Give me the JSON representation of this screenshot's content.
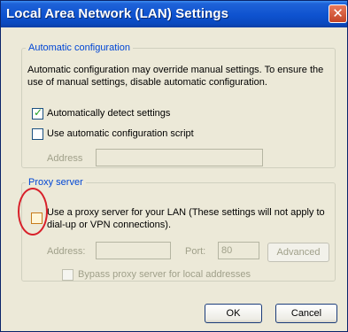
{
  "window": {
    "title": "Local Area Network (LAN) Settings",
    "close_glyph": "✕"
  },
  "automatic": {
    "legend": "Automatic configuration",
    "description": "Automatic configuration may override manual settings.  To ensure the use of manual settings, disable automatic configuration.",
    "auto_detect": {
      "label": "Automatically detect settings",
      "checked": true
    },
    "auto_script": {
      "label": "Use automatic configuration script",
      "checked": false
    },
    "address": {
      "label": "Address",
      "value": ""
    }
  },
  "proxy": {
    "legend": "Proxy server",
    "use_proxy": {
      "label": "Use a proxy server for your LAN (These settings will not apply to dial-up or VPN connections).",
      "checked": false
    },
    "address": {
      "label": "Address:",
      "value": ""
    },
    "port": {
      "label": "Port:",
      "value": "80"
    },
    "advanced_label": "Advanced",
    "bypass": {
      "label": "Bypass proxy server for local addresses",
      "checked": false
    }
  },
  "buttons": {
    "ok_label": "OK",
    "cancel_label": "Cancel"
  },
  "colors": {
    "accent": "#0046d5",
    "highlight": "#d8202a",
    "titlebar": "#0e52cf"
  }
}
